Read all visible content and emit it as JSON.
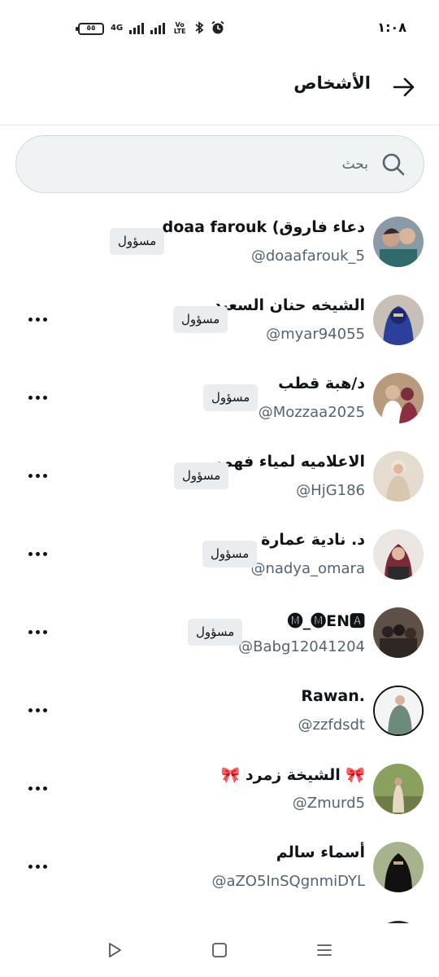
{
  "status_bar": {
    "time": "١:٠٨",
    "battery": "٥٥",
    "network": "4G",
    "volte": "Vo LTE"
  },
  "header": {
    "title": "الأشخاص"
  },
  "search": {
    "placeholder": "بحث"
  },
  "people": [
    {
      "name": "doaa farouk (دعاء فاروق",
      "handle": "@doaafarouk_5",
      "badge": "مسؤول",
      "has_more": false
    },
    {
      "name": "الشيخه حنان السعيد",
      "handle": "@myar94055",
      "badge": "مسؤول",
      "has_more": true
    },
    {
      "name": "د/هبة قطب",
      "handle": "@Mozzaa2025",
      "badge": "مسؤول",
      "has_more": true
    },
    {
      "name": "الاعلاميه لمياء فهمي",
      "handle": "@HjG186",
      "badge": "مسؤول",
      "has_more": true
    },
    {
      "name": "د. نادية عمارة",
      "handle": "@nadya_omara",
      "badge": "مسؤول",
      "has_more": true
    },
    {
      "name": "🅜_🅜EN🅰",
      "handle": "@Babg12041204",
      "badge": "مسؤول",
      "has_more": true
    },
    {
      "name": "Rawan.",
      "handle": "@zzfdsdt",
      "badge": "",
      "has_more": true
    },
    {
      "name": "🎀 الشيخة زمرد 🎀",
      "handle": "@Zmurd5",
      "badge": "",
      "has_more": true
    },
    {
      "name": "أسماء سالم",
      "handle": "@aZO5InSQgnmiDYL",
      "badge": "",
      "has_more": true
    }
  ],
  "icons": {
    "back": "arrow-right-icon",
    "search": "search-icon",
    "more": "more-horizontal-icon",
    "nav_back": "triangle-back-icon",
    "nav_home": "square-home-icon",
    "nav_recent": "menu-lines-icon"
  },
  "colors": {
    "text_primary": "#0f1419",
    "text_secondary": "#536471",
    "badge_bg": "#eaedef",
    "search_bg": "#eff3f4"
  }
}
